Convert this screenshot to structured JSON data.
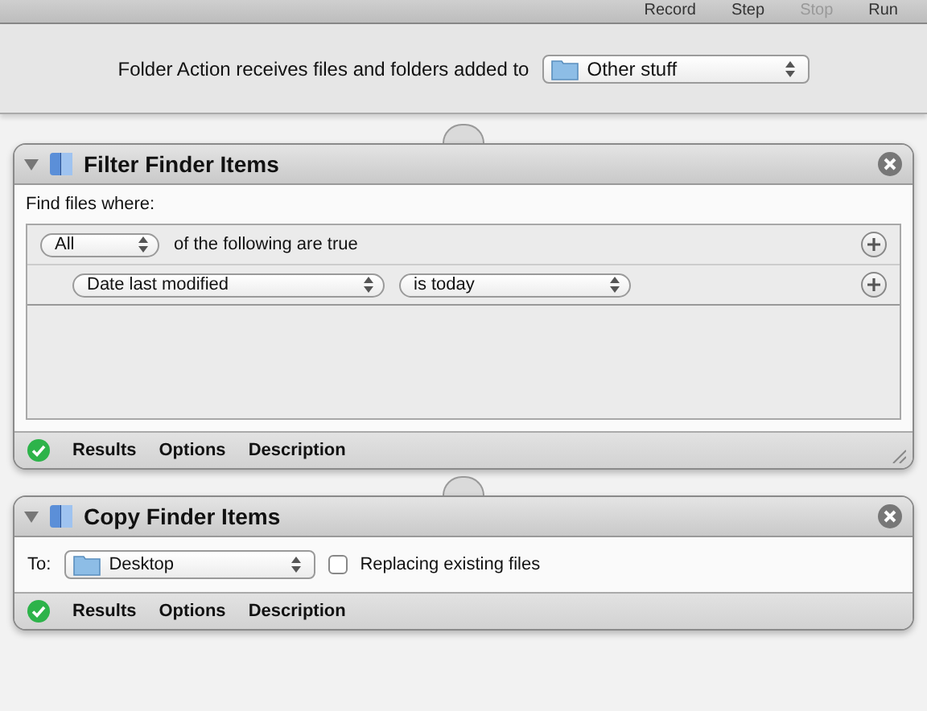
{
  "toolbar": {
    "buttons": [
      {
        "label": "Record",
        "disabled": false
      },
      {
        "label": "Step",
        "disabled": false
      },
      {
        "label": "Stop",
        "disabled": true
      },
      {
        "label": "Run",
        "disabled": false
      }
    ]
  },
  "workflow_header": {
    "label": "Folder Action receives files and folders added to",
    "folder": "Other stuff"
  },
  "actions": [
    {
      "kind": "filter",
      "title": "Filter Finder Items",
      "expanded": true,
      "prompt": "Find files where:",
      "match": {
        "quantifier": "All",
        "label": "of the following are true"
      },
      "criteria": [
        {
          "attribute": "Date last modified",
          "operator": "is today"
        }
      ],
      "footer": [
        "Results",
        "Options",
        "Description"
      ]
    },
    {
      "kind": "copy",
      "title": "Copy Finder Items",
      "expanded": true,
      "to_label": "To:",
      "destination": "Desktop",
      "replace": {
        "label": "Replacing existing files",
        "checked": false
      },
      "footer": [
        "Results",
        "Options",
        "Description"
      ]
    }
  ]
}
